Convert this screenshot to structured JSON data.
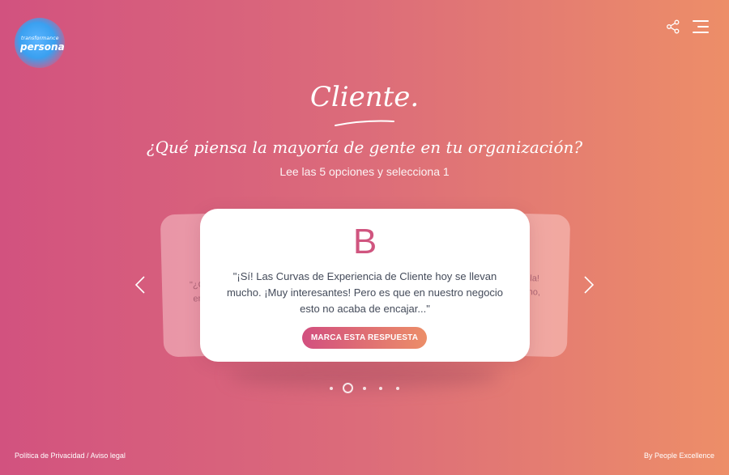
{
  "logo": {
    "line1": "transformance",
    "line2": "persona",
    "icon": "logo-icon"
  },
  "header": {
    "share_icon": "share-icon",
    "menu_icon": "hamburger-menu-icon"
  },
  "title": "Cliente.",
  "question": "¿Qué piensa la mayoría de gente en tu organización?",
  "instruction": "Lee las 5 opciones y selecciona 1",
  "carousel": {
    "prev_icon": "chevron-left-icon",
    "next_icon": "chevron-right-icon",
    "left_card": {
      "line1": "\"¿C",
      "line2": "en"
    },
    "right_card": {
      "line1": "ola!",
      "line2": "no,"
    },
    "active_card": {
      "letter": "B",
      "text": "\"¡Sí! Las Curvas de Experiencia de Cliente hoy se llevan mucho. ¡Muy interesantes! Pero es que en nuestro negocio esto no acaba de encajar...\"",
      "button_label": "MARCA ESTA RESPUESTA"
    },
    "dots": {
      "count": 5,
      "active_index": 1
    }
  },
  "footer": {
    "privacy": "Política de Privacidad",
    "separator": " / ",
    "legal": "Aviso legal",
    "credit": "By People Excellence"
  },
  "colors": {
    "gradient_start": "#d2527f",
    "gradient_end": "#ed8e68",
    "accent": "#d0557f",
    "card_text": "#444b5a"
  }
}
